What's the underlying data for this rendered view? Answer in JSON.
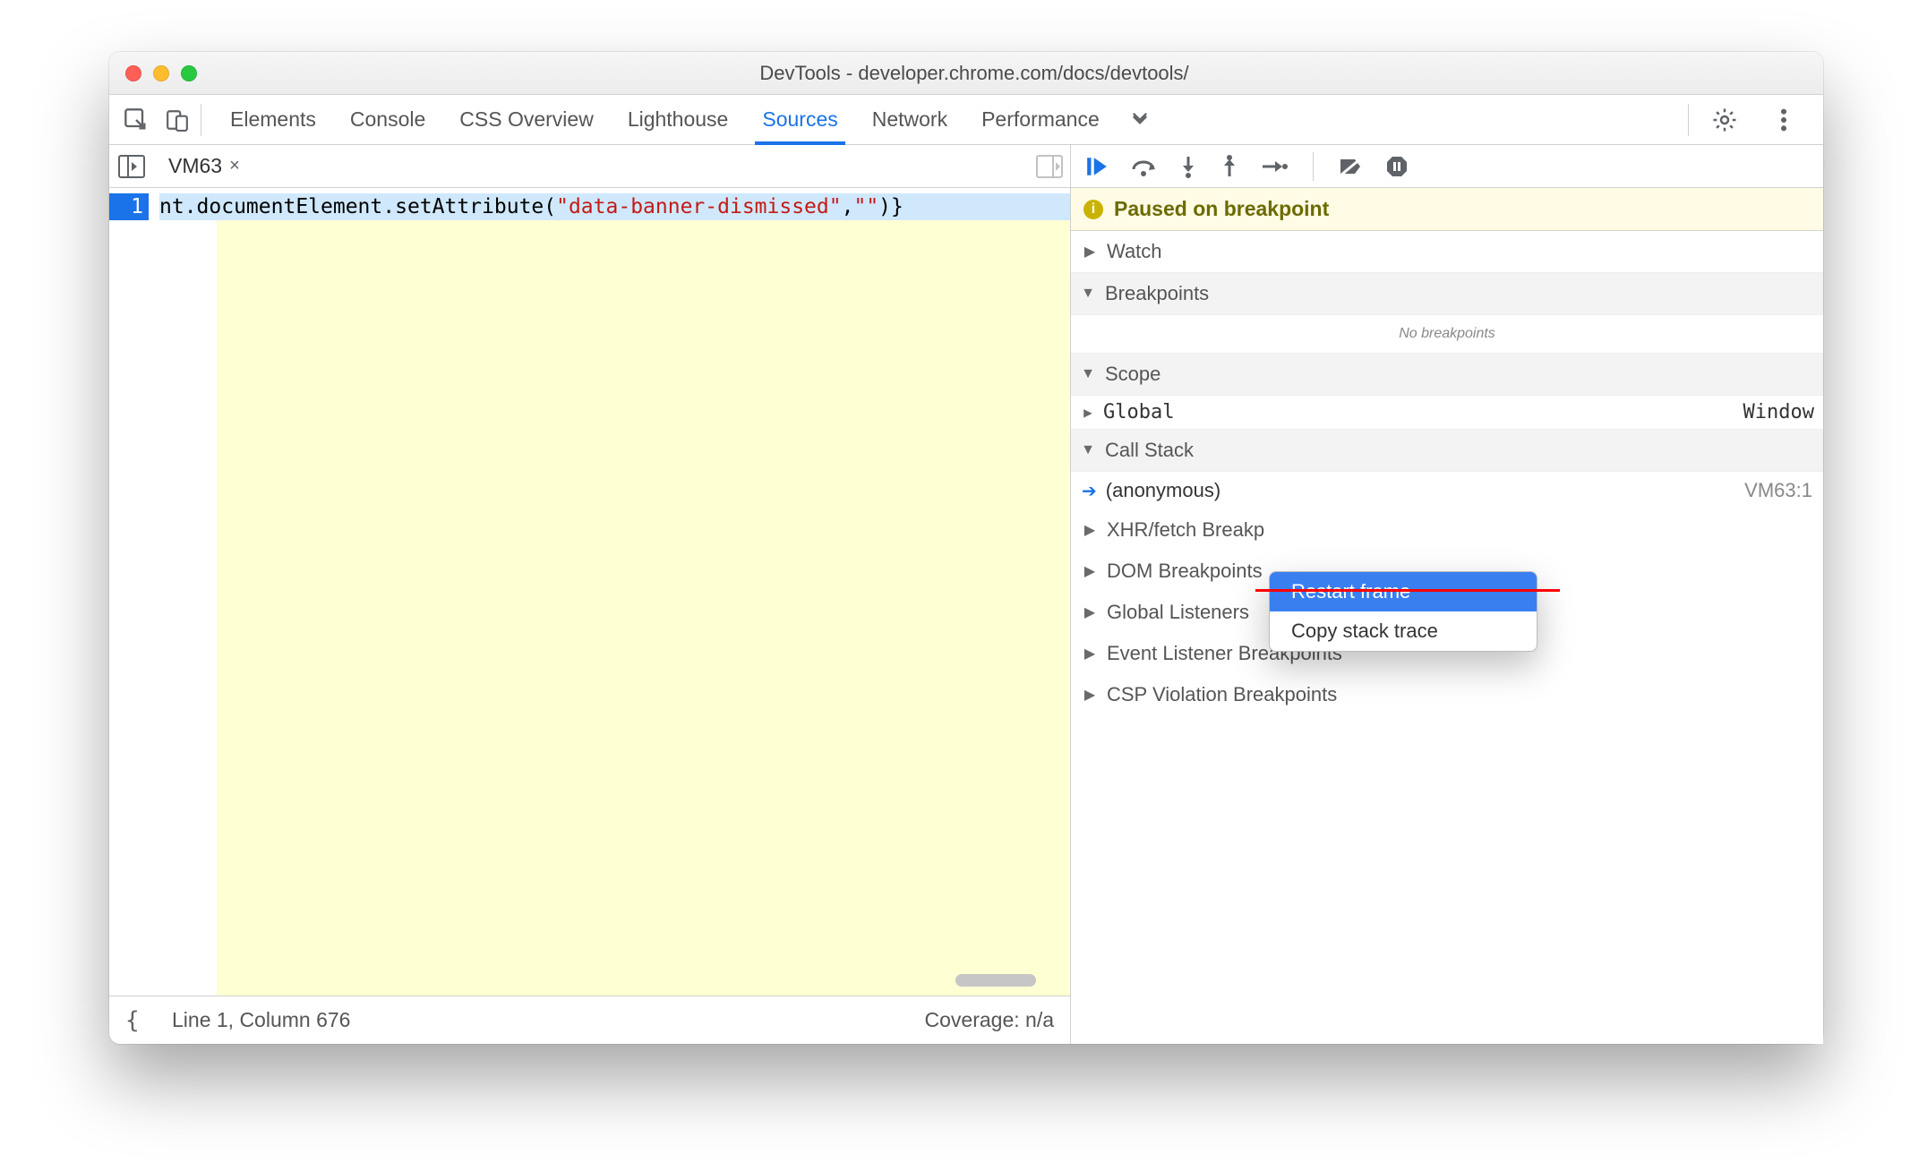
{
  "window": {
    "title": "DevTools - developer.chrome.com/docs/devtools/"
  },
  "toolbar": {
    "tabs": [
      "Elements",
      "Console",
      "CSS Overview",
      "Lighthouse",
      "Sources",
      "Network",
      "Performance"
    ],
    "active_tab": "Sources"
  },
  "source": {
    "file_tab_label": "VM63",
    "code_prefix": "nt.documentElement.setAttribute(",
    "code_string": "\"data-banner-dismissed\"",
    "code_mid": ",",
    "code_string2": "\"\"",
    "code_suffix": ")}",
    "line_number": "1"
  },
  "statusbar": {
    "pos": "Line 1, Column 676",
    "coverage": "Coverage: n/a"
  },
  "debugger": {
    "paused_label": "Paused on breakpoint",
    "sections": {
      "watch": "Watch",
      "breakpoints": "Breakpoints",
      "no_breakpoints": "No breakpoints",
      "scope": "Scope",
      "scope_global": "Global",
      "scope_global_value": "Window",
      "callstack": "Call Stack",
      "frame_label": "(anonymous)",
      "frame_src": "VM63:1",
      "xhr": "XHR/fetch Breakp",
      "dom": "DOM Breakpoints",
      "global_listeners": "Global Listeners",
      "event_listener": "Event Listener Breakpoints",
      "csp": "CSP Violation Breakpoints"
    }
  },
  "context_menu": {
    "item1": "Restart frame",
    "item2": "Copy stack trace"
  }
}
